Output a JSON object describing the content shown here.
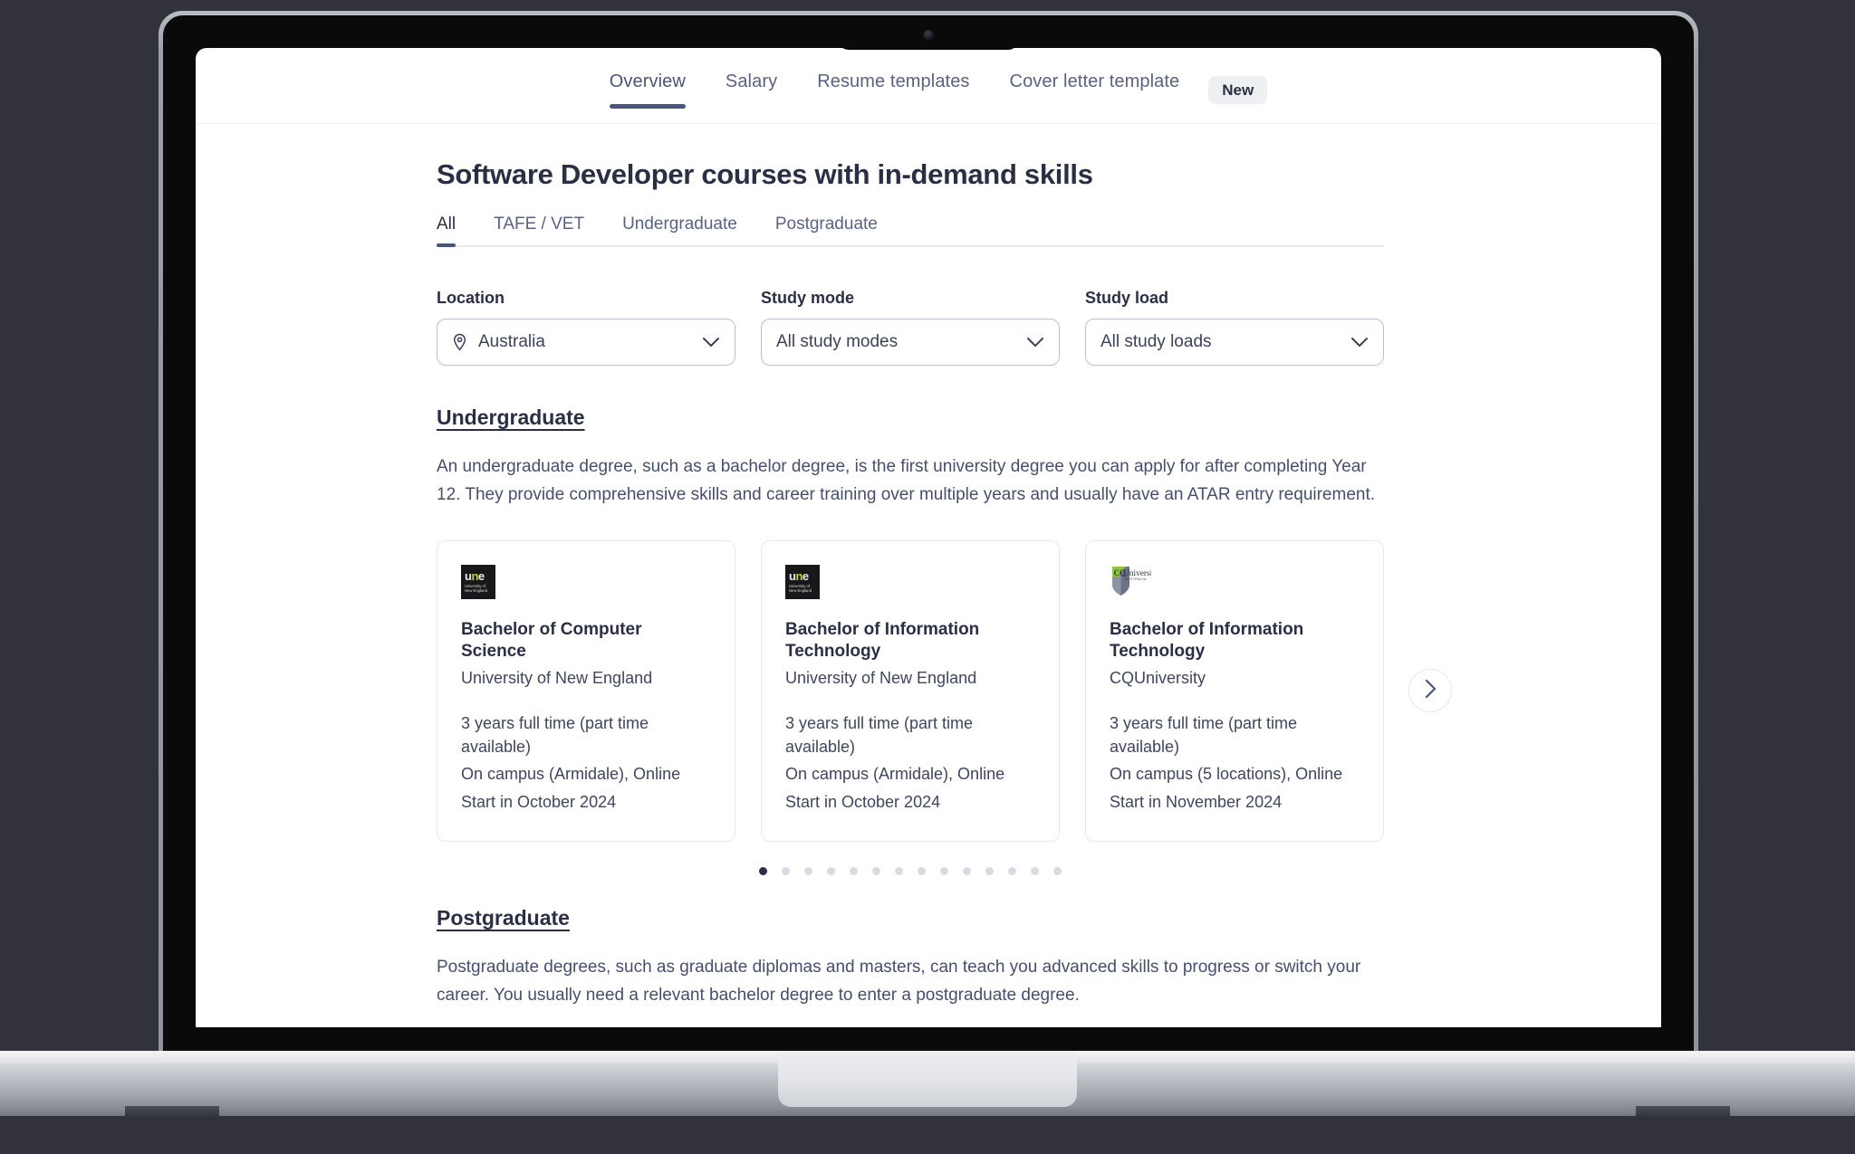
{
  "top_nav": {
    "tabs": [
      {
        "label": "Overview",
        "active": true
      },
      {
        "label": "Salary",
        "active": false
      },
      {
        "label": "Resume templates",
        "active": false
      },
      {
        "label": "Cover letter template",
        "active": false
      }
    ],
    "badge": "New"
  },
  "page": {
    "title": "Software Developer courses with in-demand skills"
  },
  "sub_tabs": [
    {
      "label": "All",
      "active": true
    },
    {
      "label": "TAFE / VET",
      "active": false
    },
    {
      "label": "Undergraduate",
      "active": false
    },
    {
      "label": "Postgraduate",
      "active": false
    }
  ],
  "filters": [
    {
      "label": "Location",
      "value": "Australia",
      "icon": "map-pin-icon",
      "has_pin": true
    },
    {
      "label": "Study mode",
      "value": "All study modes",
      "icon": "chevron-down-icon",
      "has_pin": false
    },
    {
      "label": "Study load",
      "value": "All study loads",
      "icon": "chevron-down-icon",
      "has_pin": false
    }
  ],
  "undergraduate": {
    "heading": "Undergraduate",
    "description": "An undergraduate degree, such as a bachelor degree, is the first university degree you can apply for after completing Year 12. They provide comprehensive skills and career training over multiple years and usually have an ATAR entry requirement.",
    "cards": [
      {
        "logo": "une-logo",
        "logo_main": "une",
        "logo_sub": "University of\nNew England",
        "title": "Bachelor of Computer Science",
        "provider": "University of New England",
        "duration": "3 years full time (part time available)",
        "delivery": "On campus (Armidale), Online",
        "start": "Start in October 2024"
      },
      {
        "logo": "une-logo",
        "logo_main": "une",
        "logo_sub": "University of\nNew England",
        "title": "Bachelor of Information Technology",
        "provider": "University of New England",
        "duration": "3 years full time (part time available)",
        "delivery": "On campus (Armidale), Online",
        "start": "Start in October 2024"
      },
      {
        "logo": "cqu-logo",
        "logo_main": "CQUniversity",
        "logo_sub": "AUSTRALIA",
        "title": "Bachelor of Information Technology",
        "provider": "CQUniversity",
        "duration": "3 years full time (part time available)",
        "delivery": "On campus (5 locations), Online",
        "start": "Start in November 2024"
      }
    ],
    "carousel": {
      "next_label": "Next",
      "total_dots": 14,
      "active_dot": 1
    }
  },
  "postgraduate": {
    "heading": "Postgraduate",
    "description": "Postgraduate degrees, such as graduate diplomas and masters, can teach you advanced skills to progress or switch your career. You usually need a relevant bachelor degree to enter a postgraduate degree."
  },
  "colors": {
    "accent": "#49547a",
    "text_dark": "#2b2f43",
    "text_body": "#464f6b",
    "border": "#e6e8ee",
    "badge_bg": "#edeff2",
    "desk_bg": "#32323d"
  }
}
